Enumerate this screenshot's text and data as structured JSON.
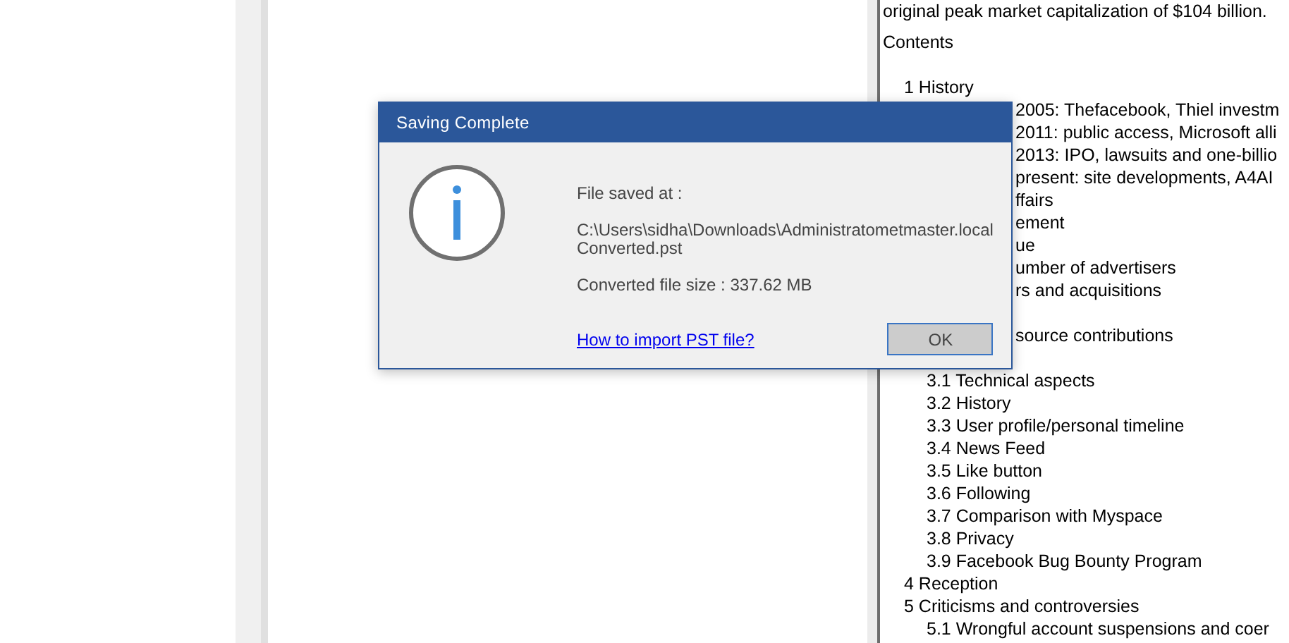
{
  "article": {
    "intro": "original peak market capitalization of $104 billion.",
    "contents_heading": "Contents",
    "contents": [
      {
        "kind": "entry",
        "text": "1 History",
        "children": [
          {
            "kind": "fragment",
            "text": "2005: Thefacebook, Thiel investm"
          },
          {
            "kind": "fragment",
            "text": "2011: public access, Microsoft alli"
          },
          {
            "kind": "fragment",
            "text": "2013: IPO, lawsuits and one-billio"
          },
          {
            "kind": "fragment",
            "text": "present: site developments, A4AI"
          }
        ]
      },
      {
        "kind": "fragment",
        "text": "ffairs",
        "children": [
          {
            "kind": "fragment",
            "text": "ement"
          },
          {
            "kind": "fragment",
            "text": "ue"
          },
          {
            "kind": "fragment",
            "text": "umber of advertisers"
          },
          {
            "kind": "fragment",
            "text": "rs and acquisitions"
          },
          {
            "kind": "covered"
          },
          {
            "kind": "fragment",
            "text": "source contributions"
          }
        ]
      },
      {
        "kind": "covered",
        "children": [
          {
            "kind": "entry",
            "text": "3.1 Technical aspects"
          },
          {
            "kind": "entry",
            "text": "3.2 History"
          },
          {
            "kind": "entry",
            "text": "3.3 User profile/personal timeline"
          },
          {
            "kind": "entry",
            "text": "3.4 News Feed"
          },
          {
            "kind": "entry",
            "text": "3.5 Like button"
          },
          {
            "kind": "entry",
            "text": "3.6 Following"
          },
          {
            "kind": "entry",
            "text": "3.7 Comparison with Myspace"
          },
          {
            "kind": "entry",
            "text": "3.8 Privacy"
          },
          {
            "kind": "entry",
            "text": "3.9 Facebook Bug Bounty Program"
          }
        ]
      },
      {
        "kind": "entry",
        "text": "4 Reception"
      },
      {
        "kind": "entry",
        "text": "5 Criticisms and controversies",
        "children": [
          {
            "kind": "entry",
            "text": "5.1 Wrongful account suspensions and coer"
          }
        ]
      }
    ]
  },
  "dialog": {
    "title": "Saving Complete",
    "label": "File saved at :",
    "path": "C:\\Users\\sidha\\Downloads\\Administratometmaster.local",
    "file": "Converted.pst",
    "size": "Converted file size : 337.62 MB",
    "link": "How to import PST file?",
    "button": "OK"
  }
}
